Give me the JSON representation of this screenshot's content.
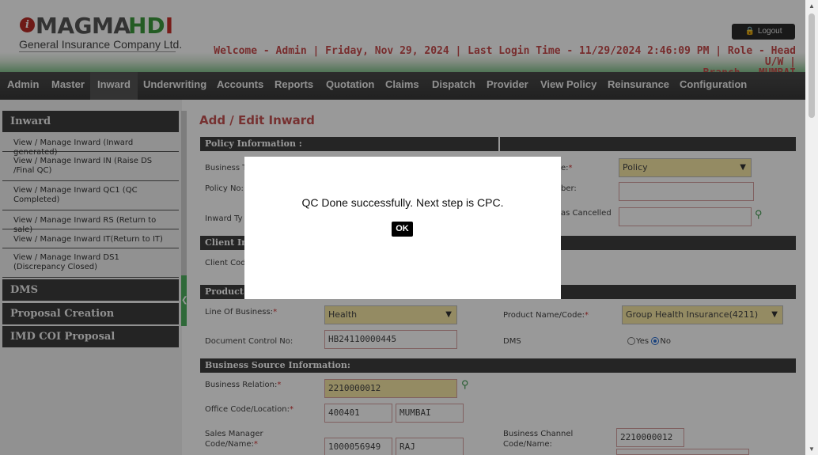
{
  "header": {
    "logo_symbol": "i",
    "logo_magma": "MAGMA",
    "logo_hd": "HD",
    "logo_i": "I",
    "logo_subtitle": "General Insurance Company Ltd.",
    "logout_label": "Logout",
    "welcome_line1": "Welcome - Admin | Friday, Nov 29, 2024 | Last Login Time - 11/29/2024 2:46:09 PM | Role - Head U/W |",
    "welcome_line2": "Branch - MUMBAI"
  },
  "nav": {
    "items": [
      "Admin",
      "Master",
      "Inward",
      "Underwriting",
      "Accounts",
      "Reports",
      "Quotation",
      "Claims",
      "Dispatch",
      "Provider",
      "View Policy",
      "Reinsurance",
      "Configuration"
    ],
    "active": "Inward"
  },
  "sidebar": {
    "inward_header": "Inward",
    "links": [
      "View / Manage Inward (Inward generated)",
      "View / Manage Inward IN (Raise DS /Final QC)",
      "View / Manage Inward QC1 (QC Completed)",
      "View / Manage Inward RS (Return to sale)",
      "View / Manage Inward IT(Return to IT)",
      "View / Manage Inward DS1 (Discrepancy Closed)"
    ],
    "sections": [
      "DMS",
      "Proposal Creation",
      "IMD COI Proposal"
    ]
  },
  "main": {
    "title": "Add / Edit Inward",
    "policy_info": {
      "header": "Policy Information :",
      "business_label": "Business T",
      "policy_no_label": "Policy No:",
      "inward_type_label": "Inward Ty",
      "type_label_tail": "e:",
      "type_value": "Policy",
      "number_label_tail": "ber:",
      "cancelled_label_tail": "as Cancelled"
    },
    "client_info": {
      "header": "Client In",
      "client_code_label": "Client Cod"
    },
    "product_info": {
      "header": "Product I",
      "lob_label": "Line Of Business:",
      "lob_value": "Health",
      "product_label": "Product Name/Code:",
      "product_value": "Group Health Insurance(4211)",
      "doc_control_label": "Document Control No:",
      "doc_control_value": "HB24110000445",
      "dms_label": "DMS",
      "dms_yes": "Yes",
      "dms_no": "No",
      "dms_selected": "No"
    },
    "business_source": {
      "header": "Business Source Information:",
      "relation_label": "Business Relation:",
      "relation_value": "2210000012",
      "office_label": "Office Code/Location:",
      "office_code": "400401",
      "office_location": "MUMBAI",
      "sales_manager_label_1": "Sales Manager",
      "sales_manager_label_2": "Code/Name:",
      "sales_manager_code": "1000056949",
      "sales_manager_name": "RAJ",
      "channel_label_1": "Business Channel",
      "channel_label_2": "Code/Name:",
      "channel_code": "2210000012"
    }
  },
  "modal": {
    "message": "QC Done successfully. Next step is CPC.",
    "ok_label": "OK"
  }
}
